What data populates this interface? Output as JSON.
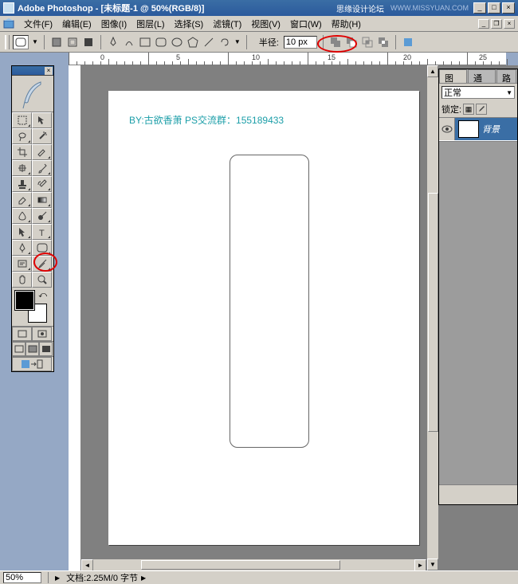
{
  "titlebar": {
    "app_name": "Adobe Photoshop",
    "doc_title": "[未标题-1 @ 50%(RGB/8)]",
    "forum_text": "思缘设计论坛",
    "url_text": "WWW.MISSYUAN.COM"
  },
  "menu": {
    "file": "文件(F)",
    "edit": "编辑(E)",
    "image": "图像(I)",
    "layer": "图层(L)",
    "select": "选择(S)",
    "filter": "滤镜(T)",
    "view": "视图(V)",
    "window": "窗口(W)",
    "help": "帮助(H)"
  },
  "options": {
    "radius_label": "半径:",
    "radius_value": "10 px"
  },
  "ruler": {
    "marks": [
      "0",
      "5",
      "10",
      "15",
      "20",
      "25"
    ]
  },
  "canvas": {
    "watermark": "BY:古欲香萧 PS交流群：155189433"
  },
  "layers_panel": {
    "tab_layers": "图层",
    "tab_channels": "通道",
    "tab_paths": "路",
    "blend_mode": "正常",
    "lock_label": "锁定:",
    "bg_layer": "背景"
  },
  "status": {
    "zoom": "50%",
    "doc_info": "文档:2.25M/0 字节"
  },
  "tools": {
    "names": [
      "move",
      "marquee",
      "lasso",
      "magic-wand",
      "crop",
      "slice",
      "healing",
      "brush",
      "stamp",
      "history-brush",
      "eraser",
      "gradient",
      "blur",
      "dodge",
      "path-select",
      "type",
      "pen",
      "rounded-rect",
      "notes",
      "eyedropper",
      "hand",
      "zoom"
    ]
  }
}
